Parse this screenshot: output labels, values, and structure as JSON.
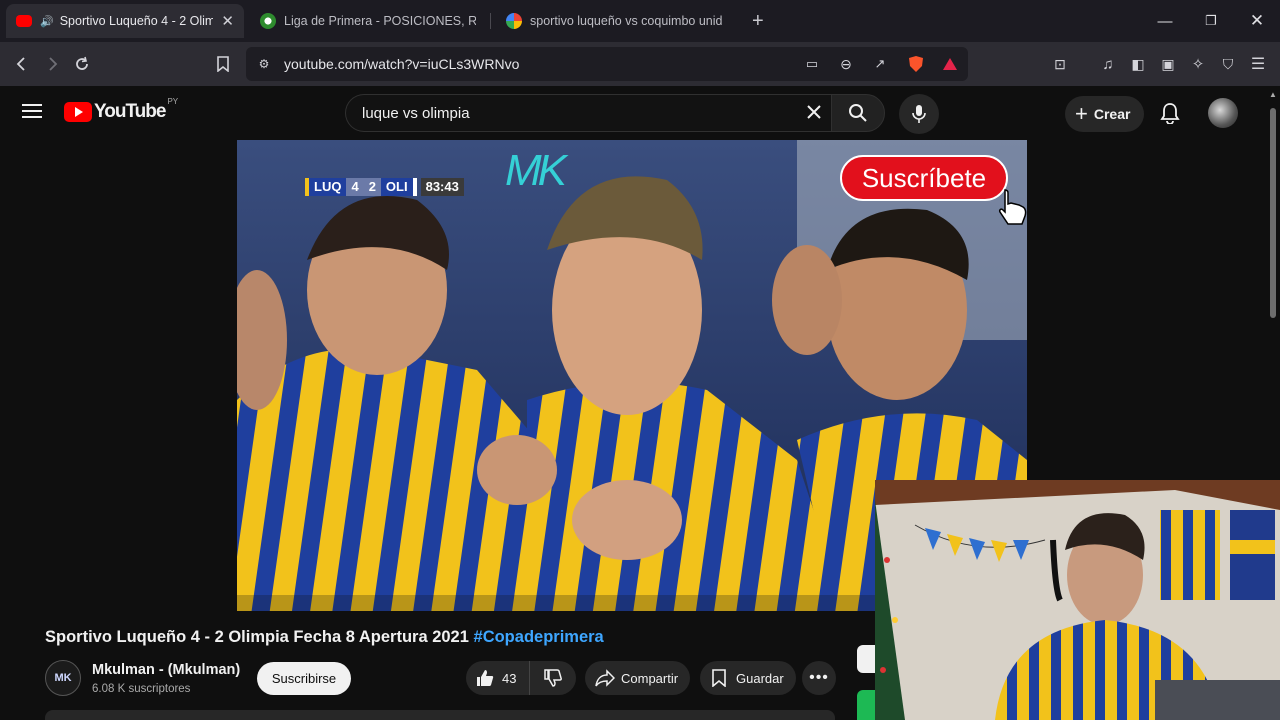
{
  "browser": {
    "tabs": [
      {
        "title": "Sportivo Luqueño 4 - 2 Olimp",
        "favicon": "youtube-icon",
        "audio": true,
        "active": true
      },
      {
        "title": "Liga de Primera - POSICIONES, RESU",
        "favicon": "soccer-ball-icon",
        "active": false
      },
      {
        "title": "sportivo luqueño vs coquimbo unido",
        "favicon": "google-icon",
        "active": false
      }
    ],
    "new_tab": "+",
    "url": "youtube.com/watch?v=iuCLs3WRNvo"
  },
  "youtube": {
    "logo_text": "YouTube",
    "region": "PY",
    "search_query": "luque vs olimpia",
    "create_label": "Crear"
  },
  "video": {
    "scoreboard": {
      "home": "LUQ",
      "home_score": "4",
      "away_score": "2",
      "away": "OLI",
      "clock": "83:43"
    },
    "watermark": "MK",
    "subscribe_overlay": "Suscríbete",
    "title": "Sportivo Luqueño 4 - 2 Olimpia Fecha 8 Apertura 2021",
    "hashtag": "#Copadeprimera"
  },
  "channel": {
    "avatar_text": "MK",
    "name": "Mkulman - (Mkulman)",
    "subscribers": "6.08 K suscriptores",
    "subscribe_label": "Suscribirse"
  },
  "actions": {
    "likes": "43",
    "share_label": "Compartir",
    "save_label": "Guardar"
  },
  "colors": {
    "yt_red": "#ff0000",
    "link_blue": "#3ea6ff",
    "jersey_yellow": "#f2c21b",
    "jersey_blue": "#1f3f9e"
  }
}
